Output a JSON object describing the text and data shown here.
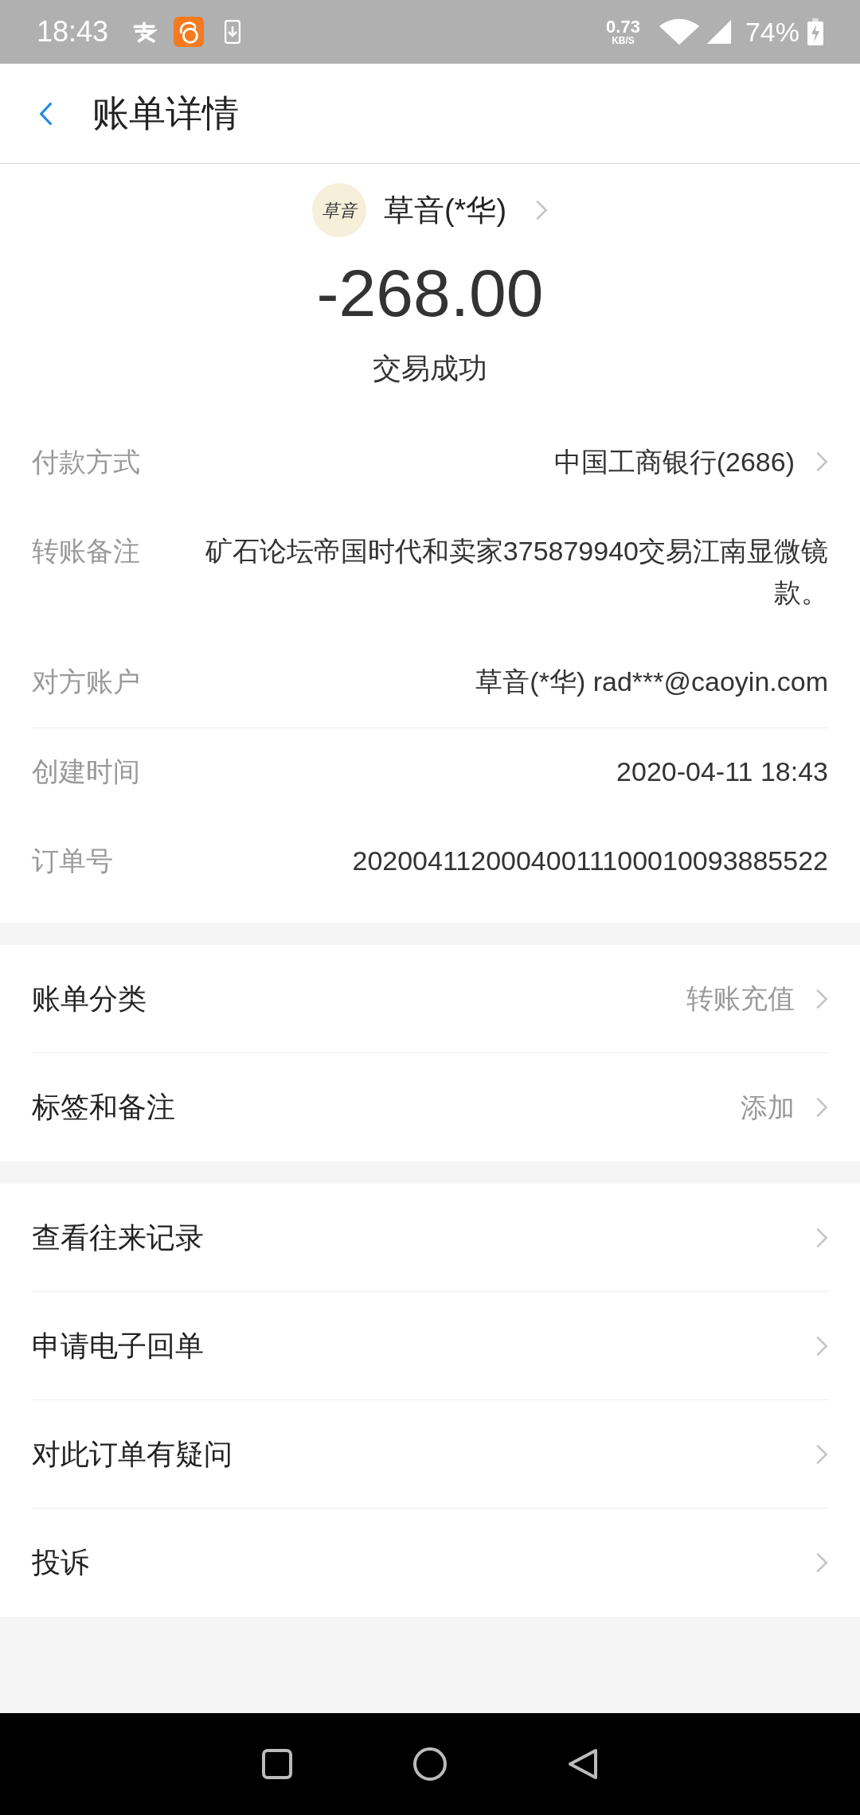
{
  "status_bar": {
    "time": "18:43",
    "net_speed": "0.73",
    "net_unit": "KB/S",
    "battery": "74%"
  },
  "header": {
    "title": "账单详情"
  },
  "payee": {
    "avatar_text": "草音",
    "name": "草音(*华)",
    "amount": "-268.00",
    "status": "交易成功"
  },
  "details": [
    {
      "label": "付款方式",
      "value": "中国工商银行(2686)",
      "arrow": true,
      "divider_after": false
    },
    {
      "label": "转账备注",
      "value": "矿石论坛帝国时代和卖家375879940交易江南显微镜款。",
      "arrow": false,
      "divider_after": false
    },
    {
      "label": "对方账户",
      "value": "草音(*华) rad***@caoyin.com",
      "arrow": false,
      "divider_after": true
    },
    {
      "label": "创建时间",
      "value": "2020-04-11 18:43",
      "arrow": false,
      "divider_after": false
    },
    {
      "label": "订单号",
      "value": "20200411200040011100010093885522",
      "arrow": false,
      "divider_after": false
    }
  ],
  "sections": [
    [
      {
        "label": "账单分类",
        "value": "转账充值"
      },
      {
        "label": "标签和备注",
        "value": "添加"
      }
    ],
    [
      {
        "label": "查看往来记录"
      },
      {
        "label": "申请电子回单"
      },
      {
        "label": "对此订单有疑问"
      },
      {
        "label": "投诉"
      }
    ]
  ]
}
